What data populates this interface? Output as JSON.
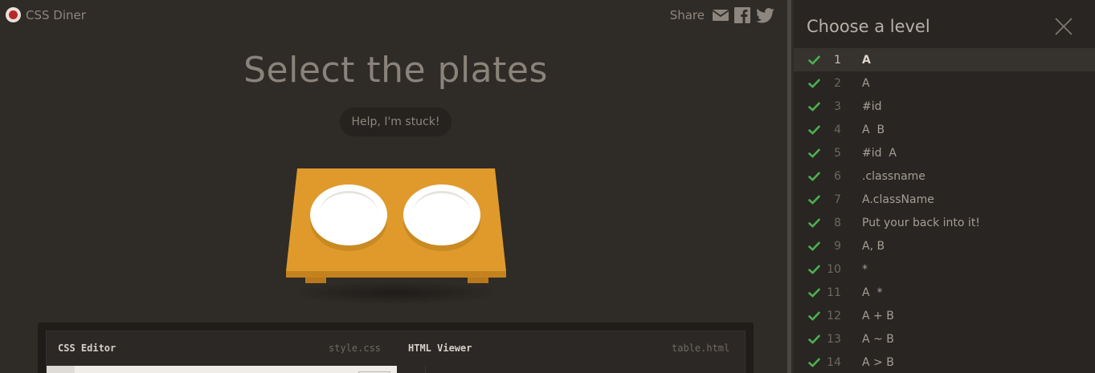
{
  "app": {
    "name": "CSS Diner"
  },
  "share": {
    "label": "Share",
    "icons": [
      "email-icon",
      "facebook-icon",
      "twitter-icon"
    ]
  },
  "level": {
    "title": "Select the plates",
    "help_label": "Help, I'm stuck!"
  },
  "editor": {
    "css": {
      "title": "CSS Editor",
      "file": "style.css"
    },
    "html": {
      "title": "HTML Viewer",
      "file": "table.html"
    }
  },
  "sidebar": {
    "title": "Choose a level",
    "levels": [
      {
        "num": "1",
        "name": "A",
        "completed": true,
        "current": true
      },
      {
        "num": "2",
        "name": "A",
        "completed": true
      },
      {
        "num": "3",
        "name": "#id",
        "completed": true
      },
      {
        "num": "4",
        "name": "A  B",
        "completed": true
      },
      {
        "num": "5",
        "name": "#id  A",
        "completed": true
      },
      {
        "num": "6",
        "name": ".classname",
        "completed": true
      },
      {
        "num": "7",
        "name": "A.className",
        "completed": true
      },
      {
        "num": "8",
        "name": "Put your back into it!",
        "completed": true
      },
      {
        "num": "9",
        "name": "A, B",
        "completed": true
      },
      {
        "num": "10",
        "name": "*",
        "completed": true
      },
      {
        "num": "11",
        "name": "A  *",
        "completed": true
      },
      {
        "num": "12",
        "name": "A + B",
        "completed": true
      },
      {
        "num": "13",
        "name": "A ~ B",
        "completed": true
      },
      {
        "num": "14",
        "name": "A > B",
        "completed": true
      }
    ]
  },
  "colors": {
    "background": "#2f2b27",
    "sidebar": "#282522",
    "table": "#e09a2c",
    "check": "#4caf50",
    "plate": "#ffffff"
  }
}
